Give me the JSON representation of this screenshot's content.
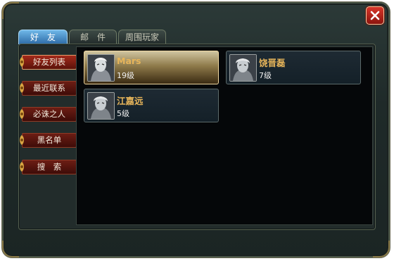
{
  "tabs": [
    {
      "label": "好　友",
      "active": true
    },
    {
      "label": "邮　件",
      "active": false
    },
    {
      "label": "周围玩家",
      "active": false
    }
  ],
  "sidebar": {
    "items": [
      {
        "label": "好友列表",
        "active": true
      },
      {
        "label": "最近联系",
        "active": false
      },
      {
        "label": "必诛之人",
        "active": false
      },
      {
        "label": "黑名单",
        "active": false
      },
      {
        "label": "搜　索",
        "active": false
      }
    ]
  },
  "friends": [
    {
      "name": "Mars",
      "level": "19级",
      "selected": true
    },
    {
      "name": "饶晋磊",
      "level": "7级",
      "selected": false
    },
    {
      "name": "江嘉远",
      "level": "5级",
      "selected": false
    }
  ],
  "colors": {
    "name_text": "#e7b55a",
    "active_tab": "#2d6aa6",
    "sidebar_button": "#6c1d14",
    "close_button": "#d8362a"
  },
  "icons": {
    "close": "close-icon",
    "avatar": "avatar-portrait",
    "ornament": "ornament-icon"
  }
}
